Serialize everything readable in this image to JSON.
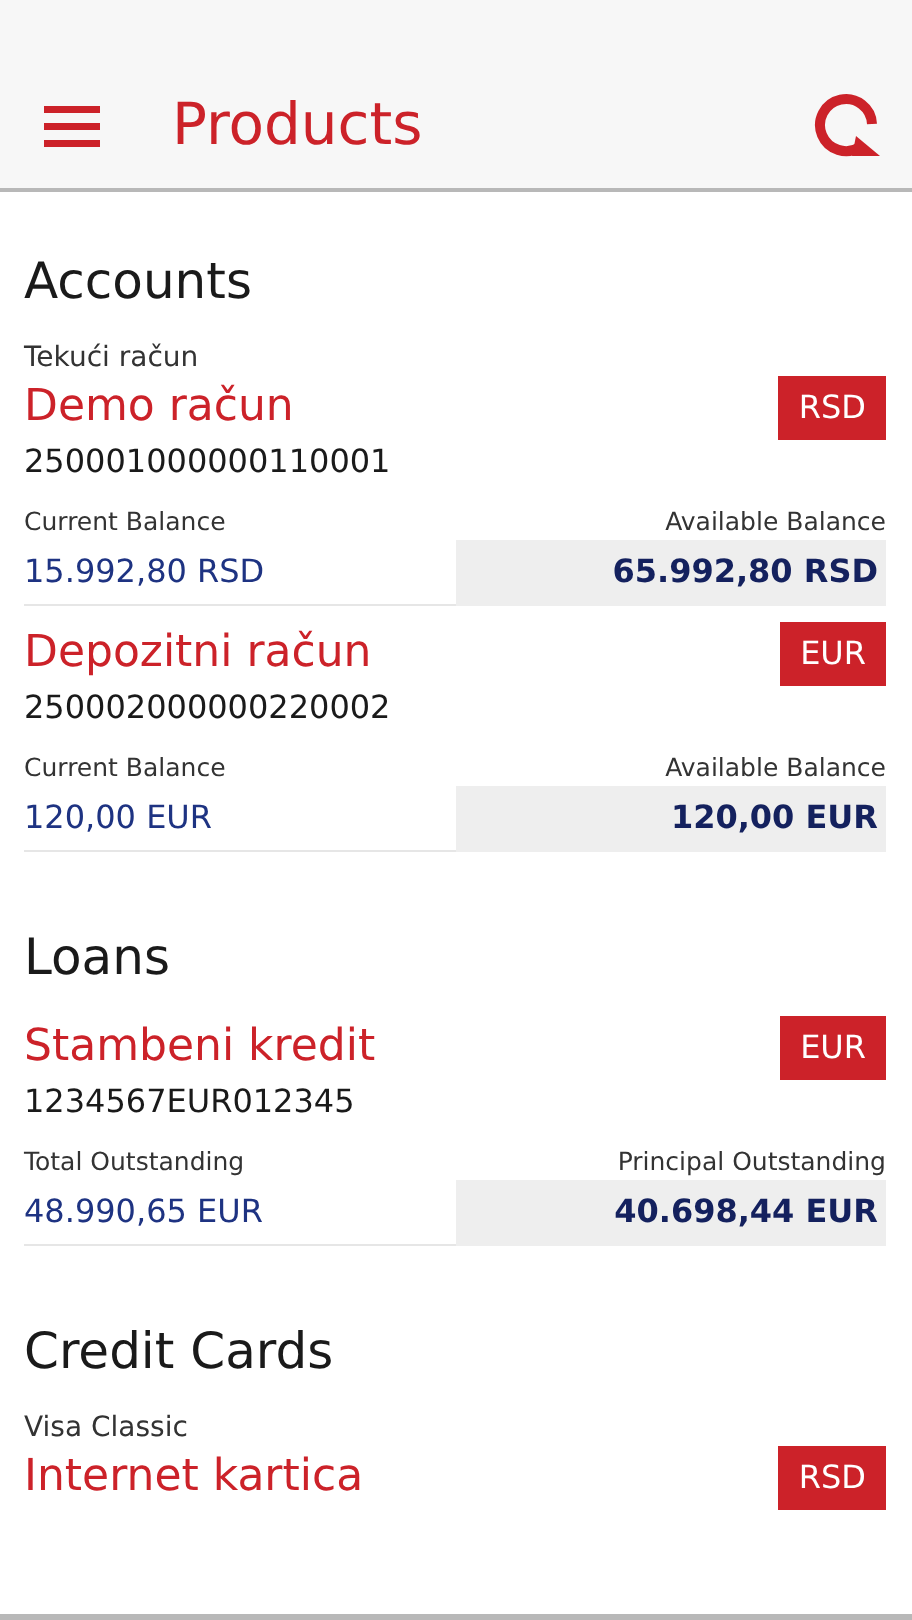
{
  "header": {
    "title": "Products"
  },
  "sections": [
    {
      "title": "Accounts",
      "products": [
        {
          "type_label": "Tekući račun",
          "name": "Demo račun",
          "number": "250001000000110001",
          "currency": "RSD",
          "left_label": "Current Balance",
          "left_value": "15.992,80 RSD",
          "right_label": "Available Balance",
          "right_value": "65.992,80 RSD"
        },
        {
          "name": "Depozitni račun",
          "number": "250002000000220002",
          "currency": "EUR",
          "left_label": "Current Balance",
          "left_value": "120,00 EUR",
          "right_label": "Available Balance",
          "right_value": "120,00 EUR"
        }
      ]
    },
    {
      "title": "Loans",
      "products": [
        {
          "name": "Stambeni kredit",
          "number": "1234567EUR012345",
          "currency": "EUR",
          "left_label": "Total Outstanding",
          "left_value": "48.990,65 EUR",
          "right_label": "Principal Outstanding",
          "right_value": "40.698,44 EUR"
        }
      ]
    },
    {
      "title": "Credit Cards",
      "products": [
        {
          "type_label": "Visa Classic",
          "name": "Internet kartica",
          "currency": "RSD"
        }
      ]
    }
  ]
}
